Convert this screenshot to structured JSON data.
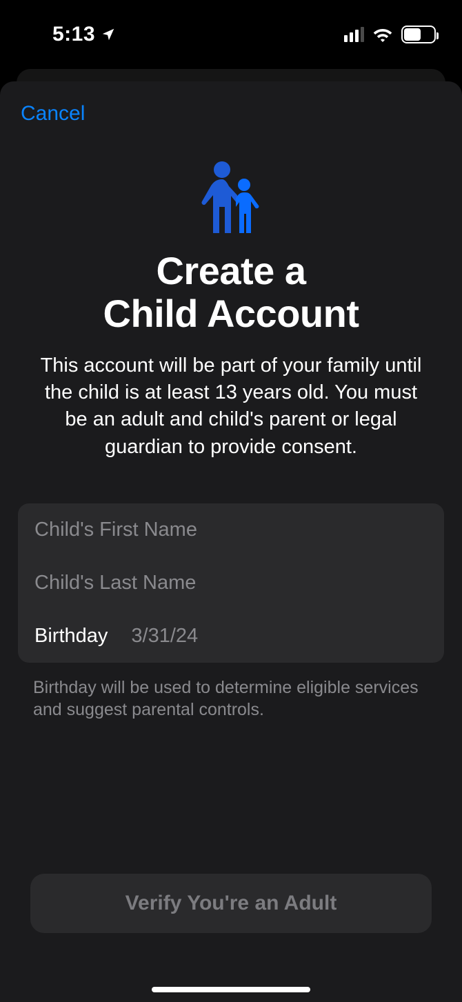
{
  "status_bar": {
    "time": "5:13",
    "battery_pct": "52"
  },
  "sheet": {
    "cancel": "Cancel",
    "title_line1": "Create a",
    "title_line2": "Child Account",
    "subtitle": "This account will be part of your family until the child is at least 13 years old. You must be an adult and child's parent or legal guardian to provide consent.",
    "fields": {
      "first_name_placeholder": "Child's First Name",
      "last_name_placeholder": "Child's Last Name",
      "birthday_label": "Birthday",
      "birthday_value": "3/31/24"
    },
    "footer_note": "Birthday will be used to determine eligible services and suggest parental controls.",
    "cta": "Verify You're an Adult"
  }
}
